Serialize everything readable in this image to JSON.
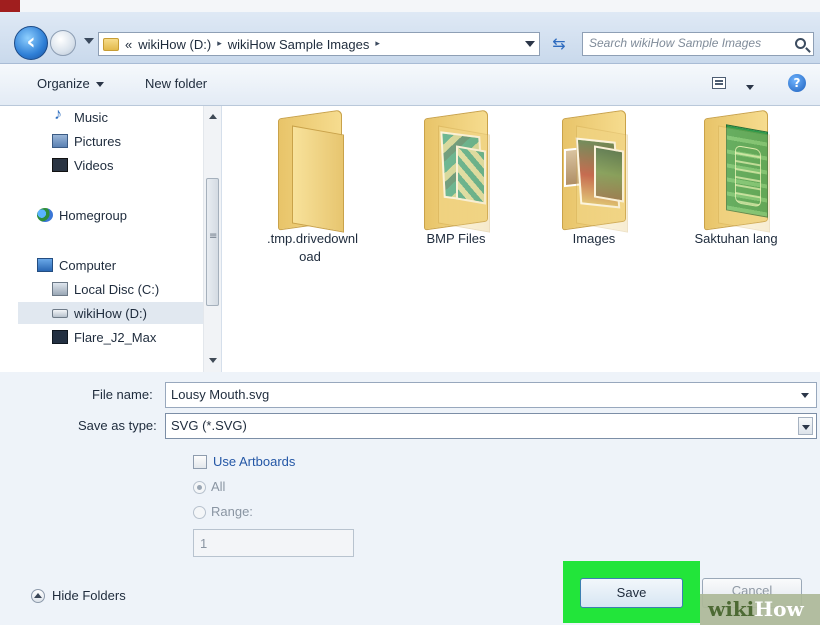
{
  "address": {
    "overflow": "«",
    "crumbs": [
      "wikiHow (D:)",
      "wikiHow Sample Images"
    ],
    "separator": "▸",
    "search_placeholder": "Search wikiHow Sample Images"
  },
  "toolbar": {
    "organize": "Organize",
    "new_folder": "New folder",
    "help": "?"
  },
  "nav": {
    "items": [
      {
        "label": "Music",
        "icon": "music-icon"
      },
      {
        "label": "Pictures",
        "icon": "pictures-icon"
      },
      {
        "label": "Videos",
        "icon": "videos-icon"
      },
      {
        "label": "Homegroup",
        "icon": "homegroup-icon"
      },
      {
        "label": "Computer",
        "icon": "computer-icon"
      },
      {
        "label": "Local Disc (C:)",
        "icon": "local-disk-icon"
      },
      {
        "label": "wikiHow (D:)",
        "icon": "drive-icon",
        "selected": true
      },
      {
        "label": "Flare_J2_Max",
        "icon": "flare-drive-icon"
      }
    ]
  },
  "folders": [
    {
      "name": ".tmp.drivedownl oad"
    },
    {
      "name": "BMP Files"
    },
    {
      "name": "Images"
    },
    {
      "name": "Saktuhan lang"
    }
  ],
  "form": {
    "file_name_label": "File name:",
    "file_name_value": "Lousy Mouth.svg",
    "save_type_label": "Save as type:",
    "save_type_value": "SVG (*.SVG)",
    "use_artboards": "Use Artboards",
    "all": "All",
    "range": "Range:",
    "range_value": "1"
  },
  "footer": {
    "hide_folders": "Hide Folders",
    "save": "Save",
    "cancel": "Cancel",
    "watermark_a": "wiki",
    "watermark_b": "How"
  },
  "colors": {
    "highlight": "#22e53a",
    "link": "#2457a6"
  }
}
